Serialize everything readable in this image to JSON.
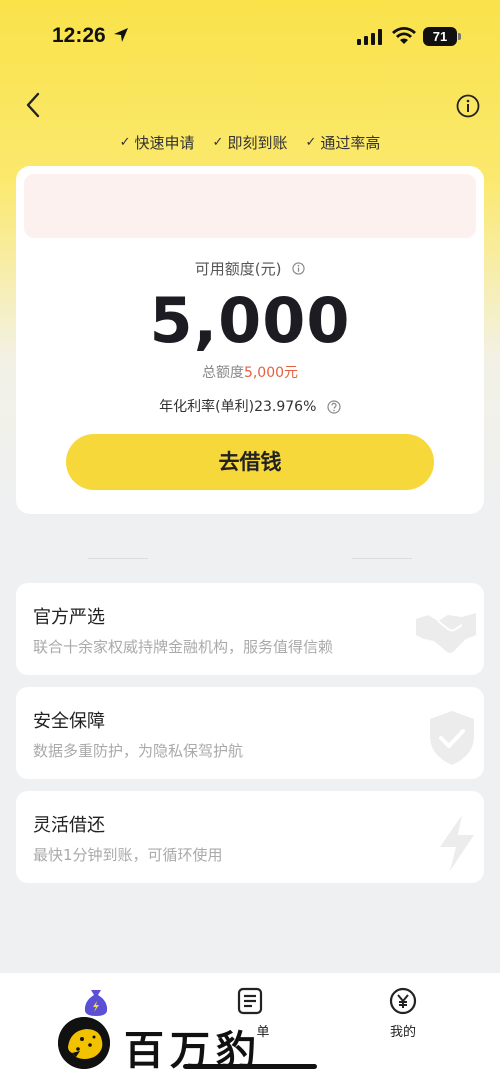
{
  "status_bar": {
    "time": "12:26",
    "battery": "71"
  },
  "header": {
    "back_icon": "chevron-left-icon",
    "info_icon": "info-circle-icon"
  },
  "features": [
    {
      "check_icon": "✓",
      "label": "快速申请"
    },
    {
      "check_icon": "✓",
      "label": "即刻到账"
    },
    {
      "check_icon": "✓",
      "label": "通过率高"
    }
  ],
  "loan_card": {
    "available_label": "可用额度(元)",
    "amount": "5,000",
    "total_prefix": "总额度",
    "total_value": "5,000元",
    "rate_text": "年化利率(单利)23.976%",
    "button_label": "去借钱"
  },
  "info_cards": [
    {
      "title": "官方严选",
      "desc": "联合十余家权威持牌金融机构，服务值得信赖",
      "icon": "handshake-icon"
    },
    {
      "title": "安全保障",
      "desc": "数据多重防护，为隐私保驾护航",
      "icon": "shield-check-icon"
    },
    {
      "title": "灵活借还",
      "desc": "最快1分钟到账，可循环使用",
      "icon": "lightning-icon"
    }
  ],
  "tabbar": {
    "tabs": [
      {
        "label": "",
        "icon": "money-bag-icon",
        "active": true
      },
      {
        "label": "单",
        "icon": "bill-icon"
      },
      {
        "label": "我的",
        "icon": "yen-circle-icon"
      }
    ]
  },
  "watermark": {
    "text": "百万豹",
    "logo": "leopard-logo-icon"
  },
  "colors": {
    "accent": "#f7d83b",
    "highlight": "#e2623f",
    "card": "#ffffff"
  }
}
